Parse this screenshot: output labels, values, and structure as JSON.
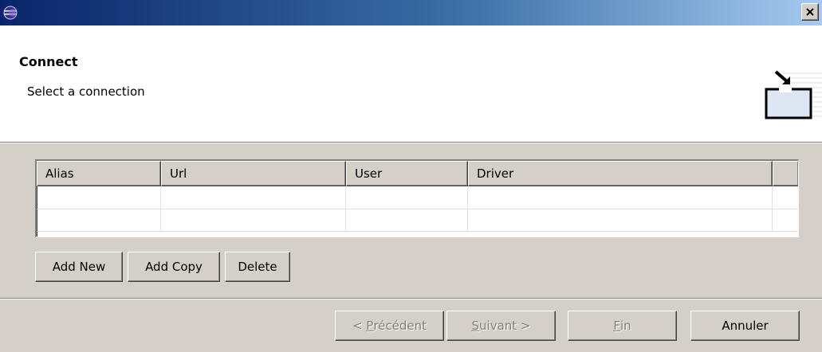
{
  "window": {
    "close_icon": "close-icon"
  },
  "header": {
    "title": "Connect",
    "description": "Select a connection"
  },
  "table": {
    "columns": [
      "Alias",
      "Url",
      "User",
      "Driver"
    ],
    "rows": [
      [
        "",
        "",
        "",
        ""
      ],
      [
        "",
        "",
        "",
        ""
      ]
    ]
  },
  "actions": {
    "add_new": "Add New",
    "add_copy": "Add Copy",
    "delete": "Delete"
  },
  "nav": {
    "back_prefix": "< ",
    "back_mnemonic": "P",
    "back_rest": "récédent",
    "next_mnemonic": "S",
    "next_rest": "uivant >",
    "finish_mnemonic": "F",
    "finish_rest": "in",
    "cancel": "Annuler"
  },
  "colors": {
    "titlebar_start": "#0a246a",
    "titlebar_end": "#a6caf0",
    "face": "#d4d0c8"
  }
}
